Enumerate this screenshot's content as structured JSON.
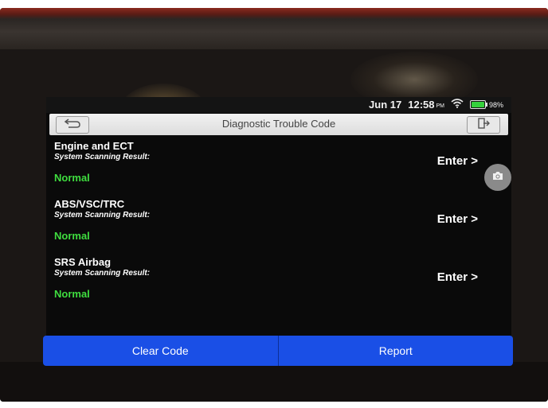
{
  "status": {
    "date": "Jun 17",
    "time": "12:58",
    "ampm": "PM",
    "battery_pct": "98%",
    "battery_level": 0.98
  },
  "header": {
    "title": "Diagnostic Trouble Code"
  },
  "systems": [
    {
      "name": "Engine and ECT",
      "label": "System Scanning Result:",
      "result": "Normal",
      "action": "Enter >"
    },
    {
      "name": "ABS/VSC/TRC",
      "label": "System Scanning Result:",
      "result": "Normal",
      "action": "Enter >"
    },
    {
      "name": "SRS Airbag",
      "label": "System Scanning Result:",
      "result": "Normal",
      "action": "Enter >"
    }
  ],
  "footer": {
    "clear_label": "Clear Code",
    "report_label": "Report"
  },
  "colors": {
    "accent": "#1a4fe6",
    "normal_status": "#3fdd3f"
  },
  "icons": {
    "back": "back-arrow-icon",
    "exit": "exit-icon",
    "wifi": "wifi-icon",
    "battery": "battery-icon",
    "camera": "camera-icon"
  }
}
